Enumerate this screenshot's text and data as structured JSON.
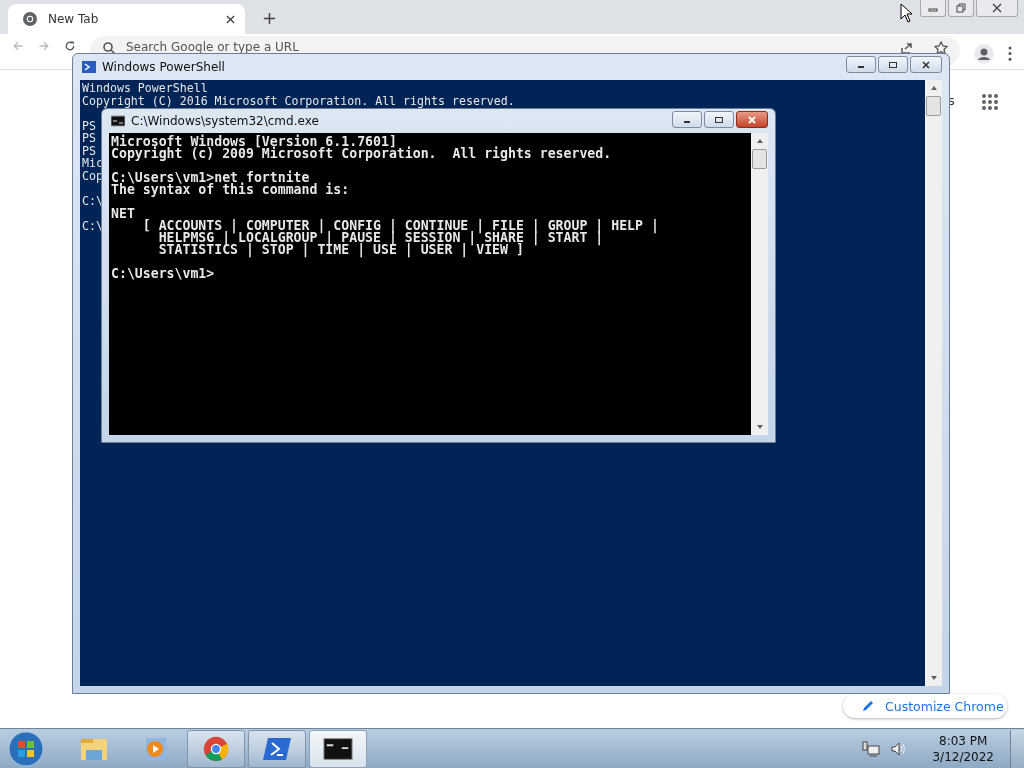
{
  "browser": {
    "tab": {
      "title": "New Tab"
    },
    "omnibox": {
      "placeholder": "Search Google or type a URL"
    },
    "page": {
      "edge_text": "s",
      "customize_button": "Customize Chrome"
    }
  },
  "powershell": {
    "title": "Windows PowerShell",
    "blocks": [
      [
        "Windows PowerShell",
        "Copyright (C) 2016 Microsoft Corporation. All rights reserved."
      ],
      [
        "PS",
        "PS",
        "PS",
        "Mic",
        "Cop"
      ],
      [
        "C:\\"
      ],
      [
        "C:\\"
      ]
    ]
  },
  "cmd": {
    "title": "C:\\Windows\\system32\\cmd.exe",
    "blocks": [
      [
        "Microsoft Windows [Version 6.1.7601]",
        "Copyright (c) 2009 Microsoft Corporation.  All rights reserved."
      ],
      [
        "C:\\Users\\vm1>net fortnite",
        "The syntax of this command is:"
      ],
      [
        "NET",
        "    [ ACCOUNTS | COMPUTER | CONFIG | CONTINUE | FILE | GROUP | HELP |",
        "      HELPMSG | LOCALGROUP | PAUSE | SESSION | SHARE | START |",
        "      STATISTICS | STOP | TIME | USE | USER | VIEW ]"
      ],
      [
        "C:\\Users\\vm1>"
      ]
    ]
  },
  "taskbar": {
    "items": [
      {
        "kind": "explorer",
        "running": false,
        "selected": false
      },
      {
        "kind": "media",
        "running": false,
        "selected": false
      },
      {
        "kind": "chrome",
        "running": true,
        "selected": false
      },
      {
        "kind": "powershell",
        "running": true,
        "selected": false
      },
      {
        "kind": "cmd",
        "running": true,
        "selected": true
      }
    ],
    "clock": {
      "time": "8:03 PM",
      "date": "3/12/2022"
    }
  }
}
